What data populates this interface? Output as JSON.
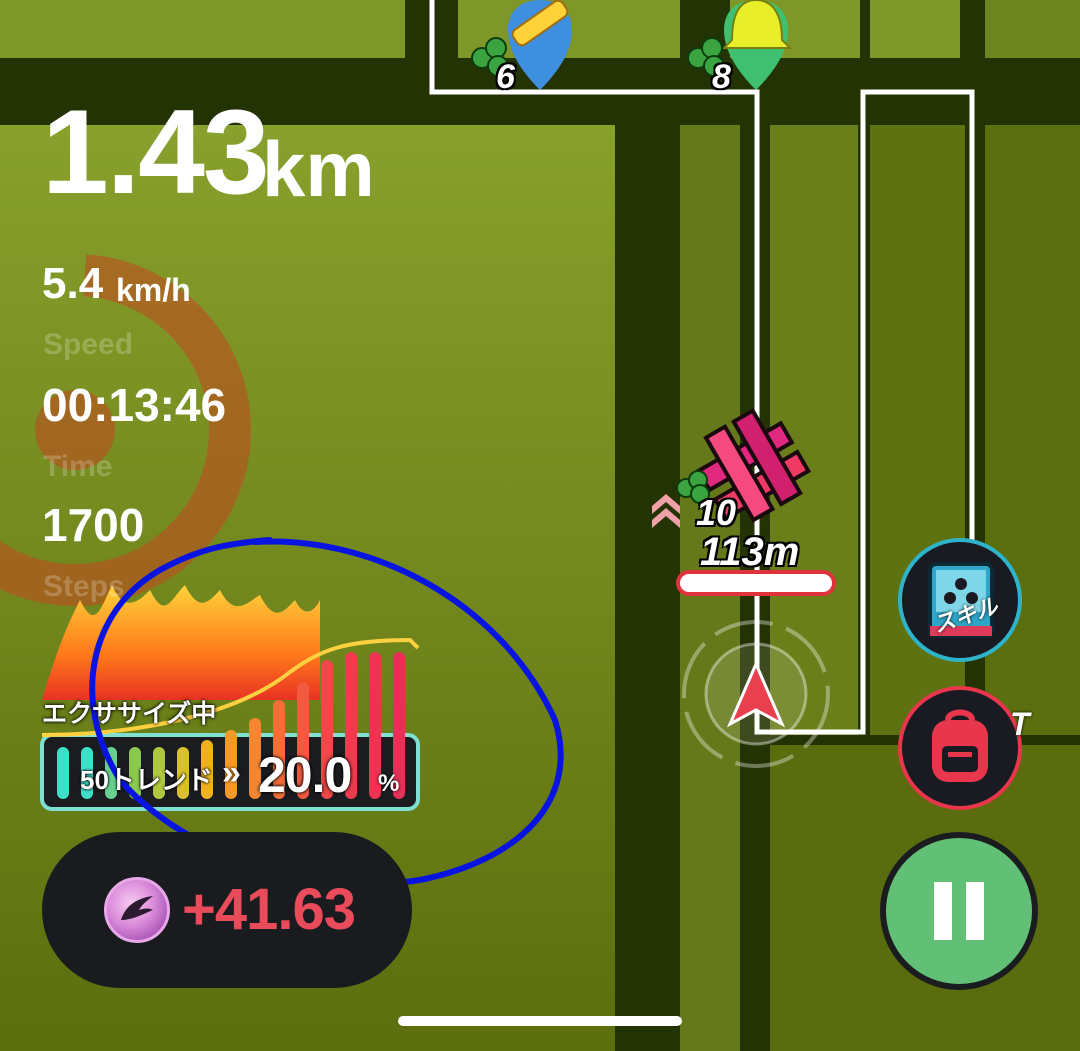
{
  "colors": {
    "map_green": "#5b6e10",
    "road_dark": "#243303",
    "route_white": "#ffffff",
    "accent_red": "#ea4b5b",
    "pause_green": "#61c076",
    "annotation_blue": "#0a14e0"
  },
  "stats": {
    "distance": {
      "value": "1.43",
      "unit": "km"
    },
    "speed": {
      "value": "5.4",
      "unit": "km/h",
      "label": "Speed"
    },
    "time": {
      "value": "00:13:46",
      "label": "Time"
    },
    "steps": {
      "value": "1700",
      "label": "Steps"
    }
  },
  "exercise": {
    "status_label": "エクササイズ中",
    "trend_label": "50トレンド",
    "trend_value": "20.0",
    "trend_unit": "%"
  },
  "reward": {
    "value": "+41.63",
    "icon": "gem-coin-icon"
  },
  "map": {
    "poi_1": {
      "icon": "scroll-pin-icon",
      "count": "6"
    },
    "poi_2": {
      "icon": "bell-pin-icon",
      "count": "8"
    },
    "player": {
      "level": "10",
      "distance": "113m"
    }
  },
  "buttons": {
    "skill": {
      "icon": "skill-book-icon",
      "label": "スキル"
    },
    "bag": {
      "icon": "backpack-icon",
      "label": "T"
    },
    "pause": {
      "icon": "pause-icon"
    }
  }
}
